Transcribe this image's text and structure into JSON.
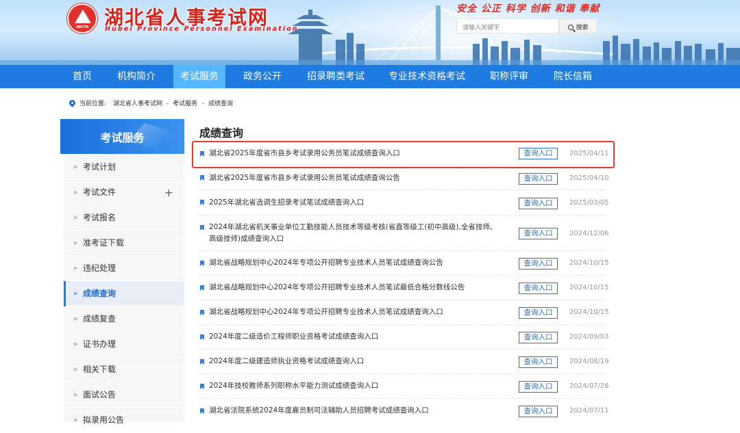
{
  "site": {
    "title": "湖北省人事考试网",
    "subtitle": "Hubei Province Personnel Examination",
    "emblem_abbr": "HBPTA",
    "slogan": "安全 公正 科学 创新 和谐 奉献"
  },
  "search": {
    "placeholder": "请输入关键字",
    "button": "搜索"
  },
  "nav": {
    "items": [
      "首页",
      "机构简介",
      "考试服务",
      "政务公开",
      "招录聘类考试",
      "专业技术资格考试",
      "职称评审",
      "院长信箱"
    ],
    "active_index": 2
  },
  "breadcrumb": {
    "label": "当前位置:",
    "path": [
      "湖北省人事考试网",
      "考试服务",
      "成绩查询"
    ],
    "separator": "-"
  },
  "sidebar": {
    "title": "考试服务",
    "items": [
      "考试计划",
      "考试文件",
      "考试报名",
      "准考证下载",
      "违纪处理",
      "成绩查询",
      "成绩复查",
      "证书办理",
      "相关下载",
      "面试公告",
      "拟录用公告"
    ],
    "active": "成绩查询",
    "expandable": "考试文件"
  },
  "main": {
    "title": "成绩查询",
    "button_label": "查询入口",
    "rows": [
      {
        "text": "湖北省2025年度省市县乡考试录用公务员笔试成绩查询入口",
        "date": "2025/04/11",
        "highlighted": true
      },
      {
        "text": "湖北省2025年度省市县乡考试录用公务员笔试成绩查询公告",
        "date": "2025/04/10"
      },
      {
        "text": "2025年湖北省选调生招录考试笔试成绩查询入口",
        "date": "2025/03/05"
      },
      {
        "text": "2024年湖北省机关事业单位工勤技能人员技术等级考核(省直等级工(初中高级),全省技师、高级技师)成绩查询入口",
        "date": "2024/12/06"
      },
      {
        "text": "湖北省战略规划中心2024年专项公开招聘专业技术人员笔试成绩查询公告",
        "date": "2024/10/15"
      },
      {
        "text": "湖北省战略规划中心2024年专项公开招聘专业技术人员笔试最低合格分数线公告",
        "date": "2024/10/15"
      },
      {
        "text": "湖北省战略规划中心2024年专项公开招聘专业技术人员笔试成绩查询入口",
        "date": "2024/10/15"
      },
      {
        "text": "2024年度二级造价工程师职业资格考试成绩查询入口",
        "date": "2024/09/03"
      },
      {
        "text": "2024年度二级建造师执业资格考试成绩查询入口",
        "date": "2024/08/19"
      },
      {
        "text": "2024年技校教师系列职称水平能力测试成绩查询入口",
        "date": "2024/07/26"
      },
      {
        "text": "湖北省法院系统2024年度雇员制司法辅助人员招聘考试成绩查询入口",
        "date": "2024/07/11"
      }
    ]
  },
  "colors": {
    "nav_bg": "#1d7be2",
    "nav_active": "#55b7ff",
    "brand_red": "#d8231c",
    "highlight_border": "#e63a2e",
    "button_border": "#2a6fc9"
  }
}
